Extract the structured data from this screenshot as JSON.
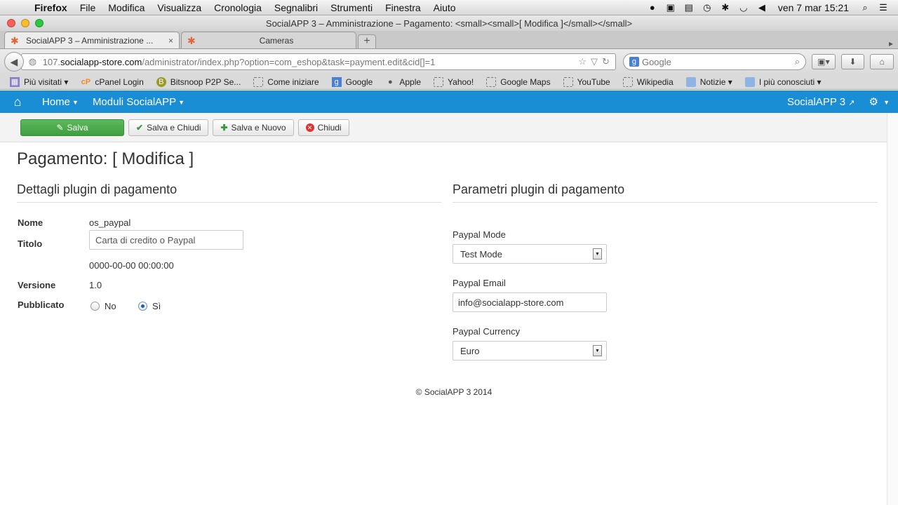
{
  "menubar": {
    "app": "Firefox",
    "items": [
      "File",
      "Modifica",
      "Visualizza",
      "Cronologia",
      "Segnalibri",
      "Strumenti",
      "Finestra",
      "Aiuto"
    ],
    "clock": "ven 7 mar  15:21"
  },
  "window": {
    "title": "SocialAPP 3 – Amministrazione – Pagamento: <small><small>[ Modifica ]</small></small>"
  },
  "tabs": [
    {
      "label": "SocialAPP 3 – Amministrazione ...",
      "close": "×"
    },
    {
      "label": "Cameras"
    }
  ],
  "newtab_label": "+",
  "address": {
    "prefix": "107.",
    "domain": "socialapp-store.com",
    "path": "/administrator/index.php?option=com_eshop&task=payment.edit&cid[]=1"
  },
  "search": {
    "placeholder": "Google"
  },
  "bookmarks": [
    {
      "label": "Più visitati ▾",
      "icon": "most-visited-icon"
    },
    {
      "label": "cPanel Login",
      "icon": "cpanel-icon"
    },
    {
      "label": "Bitsnoop P2P Se...",
      "icon": "bitsnoop-icon"
    },
    {
      "label": "Come iniziare",
      "icon": "page-icon"
    },
    {
      "label": "Google",
      "icon": "google-icon"
    },
    {
      "label": "Apple",
      "icon": "apple-icon"
    },
    {
      "label": "Yahoo!",
      "icon": "page-icon"
    },
    {
      "label": "Google Maps",
      "icon": "page-icon"
    },
    {
      "label": "YouTube",
      "icon": "page-icon"
    },
    {
      "label": "Wikipedia",
      "icon": "page-icon"
    },
    {
      "label": "Notizie ▾",
      "icon": "folder-icon"
    },
    {
      "label": "I più conosciuti ▾",
      "icon": "folder-icon"
    }
  ],
  "admin_nav": {
    "home": "Home",
    "modules": "Moduli SocialAPP",
    "brand": "SocialAPP 3"
  },
  "toolbar": {
    "save": "Salva",
    "save_close": "Salva e Chiudi",
    "save_new": "Salva e Nuovo",
    "close": "Chiudi"
  },
  "page": {
    "title": "Pagamento: [ Modifica ]",
    "details_title": "Dettagli plugin di pagamento",
    "params_title": "Parametri plugin di pagamento"
  },
  "details": {
    "name_label": "Nome",
    "name_value": "os_paypal",
    "title_label": "Titolo",
    "title_value": "Carta di credito o Paypal",
    "date_value": "0000-00-00 00:00:00",
    "version_label": "Versione",
    "version_value": "1.0",
    "published_label": "Pubblicato",
    "published_no": "No",
    "published_yes": "Sì",
    "published_selected": "Sì"
  },
  "params": {
    "mode_label": "Paypal Mode",
    "mode_value": "Test Mode",
    "email_label": "Paypal Email",
    "email_value": "info@socialapp-store.com",
    "currency_label": "Paypal Currency",
    "currency_value": "Euro"
  },
  "footer": "© SocialAPP 3 2014"
}
